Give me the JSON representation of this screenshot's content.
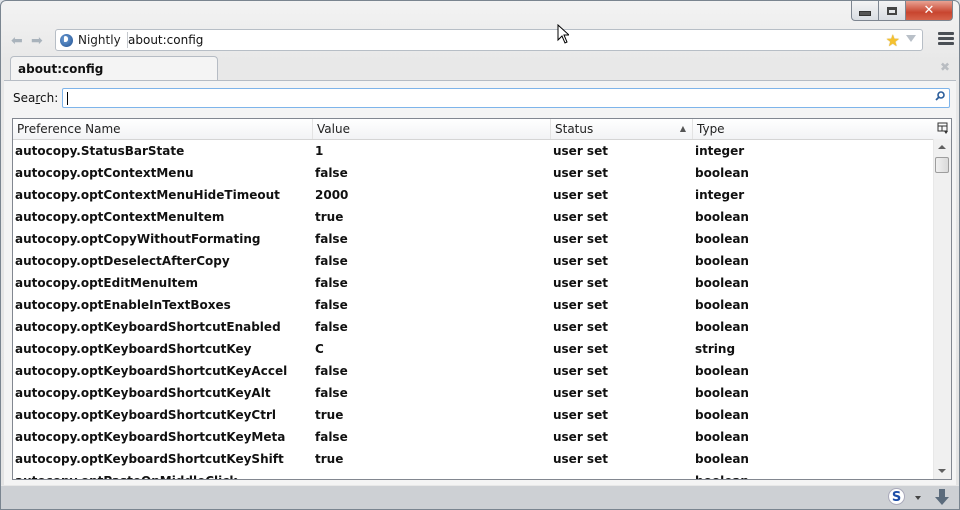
{
  "window": {
    "caption_buttons": [
      "minimize",
      "maximize",
      "close"
    ]
  },
  "navbar": {
    "back_icon": "back-arrow-icon",
    "forward_icon": "forward-arrow-icon",
    "identity_label": "Nightly",
    "url": "about:config",
    "bookmark_icon": "star-icon",
    "menu_icon": "hamburger-menu-icon"
  },
  "tabs": [
    {
      "label": "about:config",
      "active": true
    }
  ],
  "search": {
    "label_pre": "Sea",
    "label_accel": "r",
    "label_post": "ch:",
    "value": "",
    "placeholder": ""
  },
  "table": {
    "columns": [
      {
        "label": "Preference Name"
      },
      {
        "label": "Value"
      },
      {
        "label": "Status",
        "sorted": "ascending"
      },
      {
        "label": "Type"
      }
    ],
    "rows": [
      {
        "name": "autocopy.StatusBarState",
        "value": "1",
        "status": "user set",
        "type": "integer"
      },
      {
        "name": "autocopy.optContextMenu",
        "value": "false",
        "status": "user set",
        "type": "boolean"
      },
      {
        "name": "autocopy.optContextMenuHideTimeout",
        "value": "2000",
        "status": "user set",
        "type": "integer"
      },
      {
        "name": "autocopy.optContextMenuItem",
        "value": "true",
        "status": "user set",
        "type": "boolean"
      },
      {
        "name": "autocopy.optCopyWithoutFormating",
        "value": "false",
        "status": "user set",
        "type": "boolean"
      },
      {
        "name": "autocopy.optDeselectAfterCopy",
        "value": "false",
        "status": "user set",
        "type": "boolean"
      },
      {
        "name": "autocopy.optEditMenuItem",
        "value": "false",
        "status": "user set",
        "type": "boolean"
      },
      {
        "name": "autocopy.optEnableInTextBoxes",
        "value": "false",
        "status": "user set",
        "type": "boolean"
      },
      {
        "name": "autocopy.optKeyboardShortcutEnabled",
        "value": "false",
        "status": "user set",
        "type": "boolean"
      },
      {
        "name": "autocopy.optKeyboardShortcutKey",
        "value": "C",
        "status": "user set",
        "type": "string"
      },
      {
        "name": "autocopy.optKeyboardShortcutKeyAccel",
        "value": "false",
        "status": "user set",
        "type": "boolean"
      },
      {
        "name": "autocopy.optKeyboardShortcutKeyAlt",
        "value": "false",
        "status": "user set",
        "type": "boolean"
      },
      {
        "name": "autocopy.optKeyboardShortcutKeyCtrl",
        "value": "true",
        "status": "user set",
        "type": "boolean"
      },
      {
        "name": "autocopy.optKeyboardShortcutKeyMeta",
        "value": "false",
        "status": "user set",
        "type": "boolean"
      },
      {
        "name": "autocopy.optKeyboardShortcutKeyShift",
        "value": "true",
        "status": "user set",
        "type": "boolean"
      },
      {
        "name": "autocopy.optPasteOnMiddleClick",
        "value": "",
        "status": "",
        "type": "boolean"
      }
    ]
  },
  "addon_bar": {
    "s_icon_label": "S",
    "download_icon": "download-arrow-icon"
  },
  "colors": {
    "close_button": "#c8452f",
    "search_border": "#7eb4ea",
    "star": "#f5c12e",
    "addon_bar": "#cdd0d4"
  }
}
